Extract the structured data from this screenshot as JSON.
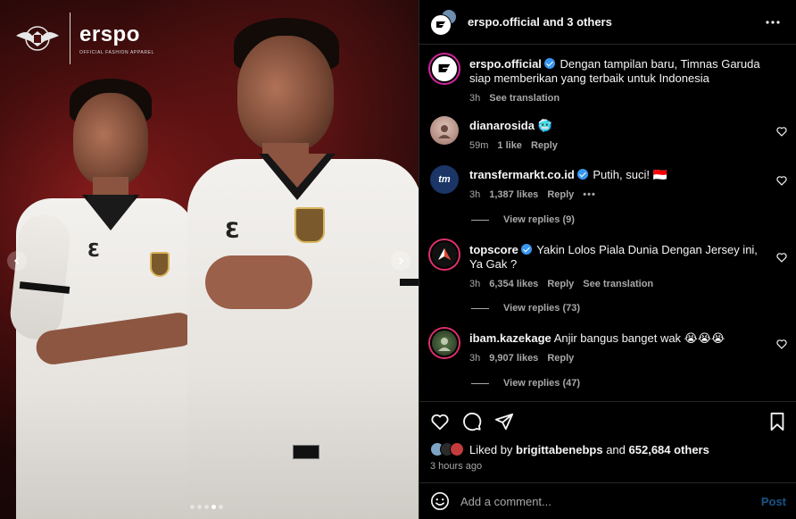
{
  "header": {
    "username": "erspo.official",
    "others_text": "and 3 others",
    "more_icon": "more-horizontal-icon"
  },
  "media": {
    "brand_name": "erspo",
    "brand_tagline": "OFFICIAL FASHION APPAREL",
    "left_arrow_icon": "chevron-left-icon",
    "right_arrow_icon": "chevron-right-icon",
    "carousel_dots": 5,
    "active_dot": 3
  },
  "caption": {
    "username": "erspo.official",
    "text": "Dengan tampilan baru, Timnas Garuda siap memberikan yang terbaik untuk Indonesia",
    "time": "3h",
    "see_translation": "See translation"
  },
  "comments": [
    {
      "username": "dianarosida",
      "verified": false,
      "text": "🥶",
      "time": "59m",
      "likes": "1 like",
      "reply": "Reply",
      "avatar_color": "#c9a9a0"
    },
    {
      "username": "transfermarkt.co.id",
      "verified": true,
      "text": "Putih, suci! 🇮🇩",
      "time": "3h",
      "likes": "1,387 likes",
      "reply": "Reply",
      "extra": "•••",
      "view_replies": "View replies (9)",
      "avatar_color": "#1a3566",
      "avatar_text": "tm"
    },
    {
      "username": "topscore",
      "verified": true,
      "text": "Yakin Lolos Piala Dunia Dengan Jersey ini, Ya Gak ?",
      "time": "3h",
      "likes": "6,354 likes",
      "reply": "Reply",
      "see_translation": "See translation",
      "view_replies": "View replies (73)",
      "avatar_color": "#111111"
    },
    {
      "username": "ibam.kazekage",
      "verified": false,
      "text": "Anjir bangus banget wak 😭😭😭",
      "time": "3h",
      "likes": "9,907 likes",
      "reply": "Reply",
      "view_replies": "View replies (47)",
      "avatar_color": "#2f4a2a"
    }
  ],
  "actions": {
    "like_icon": "heart-icon",
    "comment_icon": "comment-icon",
    "share_icon": "send-icon",
    "save_icon": "bookmark-icon",
    "liked_by_prefix": "Liked by",
    "liked_by_user": "brigittabenebps",
    "liked_by_and": "and",
    "liked_by_count": "652,684 others",
    "posted_time": "3 hours ago"
  },
  "add_comment": {
    "emoji_icon": "emoji-icon",
    "placeholder": "Add a comment...",
    "post_label": "Post"
  },
  "colors": {
    "verified": "#3897f0",
    "post_button": "#1a5488",
    "muted_text": "#a8a8a8",
    "border": "#262626"
  }
}
